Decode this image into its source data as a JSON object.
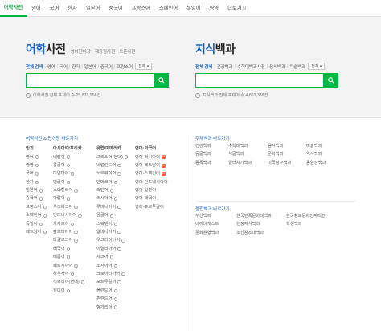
{
  "nav": {
    "items": [
      "어학사전",
      "영어",
      "국어",
      "한자",
      "일본어",
      "중국어",
      "프랑스어",
      "스페인어",
      "독일어",
      "영영"
    ],
    "more_label": "더보기",
    "more_arrow": "N"
  },
  "dict": {
    "title_accent": "어학",
    "title_rest": "사전",
    "sub_links": [
      "영어단어장",
      "제공형사전",
      "오픈사전"
    ],
    "filters_active": "전체 검색",
    "filters": [
      "영어",
      "국어",
      "한자",
      "일본어",
      "중국어",
      "프랑스어"
    ],
    "dropdown": "전체 ▾",
    "input_placeholder": "",
    "stat": "어학사전 전체 표제어 수 25,878,956건"
  },
  "encyclopedia": {
    "title_accent": "지식",
    "title_rest": "백과",
    "filters_active": "전체 검색",
    "filters": [
      "건강백과",
      "수학대백과사전",
      "음식백과",
      "미술백과"
    ],
    "dropdown": "전체 ▾",
    "input_placeholder": "",
    "stat": "지식백과 전체 표제어 수 4,863,338건"
  },
  "lang_section": {
    "title": "어학사전 & 단어장 바로가기",
    "columns": [
      {
        "head": "인기",
        "items": [
          "영어",
          "영영",
          "국어",
          "한자",
          "일본어",
          "중국어",
          "프랑스어",
          "스페인어",
          "독일어",
          "베트남어"
        ]
      },
      {
        "head": "아시아/아프리카",
        "items": [
          "네팔어",
          "몽골어",
          "미얀마어",
          "벵골어",
          "스와힐리어",
          "아랍어",
          "우즈베크어",
          "인도네시아어",
          "카자흐어",
          "캄보디아어",
          "타갈로그어",
          "태국어",
          "테툼어",
          "페르시아어",
          "하우사어",
          "히브리어(현대)",
          "힌디어"
        ]
      },
      {
        "head": "유럽/아메리카",
        "items": [
          "그리스어(현대)",
          "네덜란드어",
          "노르웨이어",
          "덴마크어",
          "라틴어",
          "러시아어",
          "루마니아어",
          "몽골어",
          "스웨덴어",
          "알바니아어",
          "우크라이나어",
          "이탈리아어",
          "체코어",
          "조지아어",
          "크로아티아어",
          "포르투갈어",
          "폴란드어",
          "핀란드어",
          "헝가리어"
        ]
      },
      {
        "head": "영어·외국어",
        "items": [
          "영어-러시아어",
          "영어-베트남어",
          "영어-스페인어",
          "영어-인도네시아어",
          "영어-일본어",
          "영어-태국어",
          "영어-포르투갈어"
        ]
      }
    ]
  },
  "topic_section": {
    "title": "주제백과 바로가기",
    "columns": [
      {
        "items": [
          "건강백과",
          "동물백과",
          "종목백과"
        ]
      },
      {
        "items": [
          "수학대백과",
          "식물백과",
          "일터치기백과"
        ]
      },
      {
        "items": [
          "음식백과",
          "문화백과",
          "미국탐구백과"
        ]
      },
      {
        "items": [
          "미술백과",
          "역사백과",
          "동양상백과"
        ]
      }
    ]
  },
  "general_section": {
    "title": "종합백과 바로가기",
    "columns": [
      {
        "items": [
          "두산백과",
          "네이버캐스트",
          "문화원형백과"
        ]
      },
      {
        "items": [
          "한국민족문화대백과",
          "현장지식백과",
          "조선왕조대백과"
        ]
      },
      {
        "items": [
          "한국향토문화전자대전",
          "학생백과"
        ]
      }
    ]
  },
  "colors": {
    "accent_green": "#00b843",
    "link_blue": "#1c64c8",
    "new_badge": "#ff5a2d"
  }
}
